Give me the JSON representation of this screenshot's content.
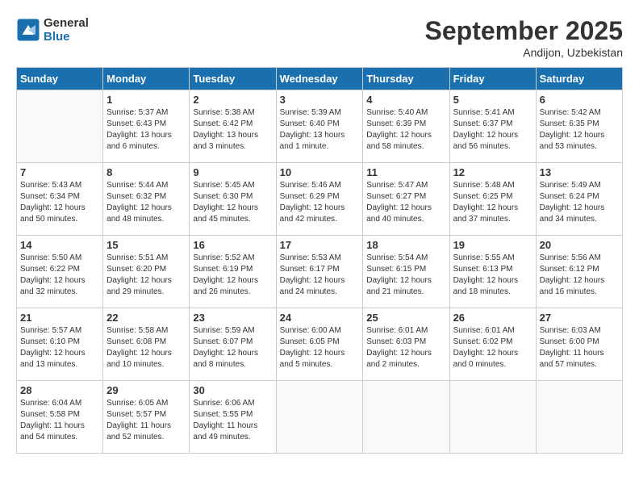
{
  "header": {
    "logo_line1": "General",
    "logo_line2": "Blue",
    "month": "September 2025",
    "location": "Andijon, Uzbekistan"
  },
  "weekdays": [
    "Sunday",
    "Monday",
    "Tuesday",
    "Wednesday",
    "Thursday",
    "Friday",
    "Saturday"
  ],
  "weeks": [
    [
      {
        "day": "",
        "info": ""
      },
      {
        "day": "1",
        "info": "Sunrise: 5:37 AM\nSunset: 6:43 PM\nDaylight: 13 hours\nand 6 minutes."
      },
      {
        "day": "2",
        "info": "Sunrise: 5:38 AM\nSunset: 6:42 PM\nDaylight: 13 hours\nand 3 minutes."
      },
      {
        "day": "3",
        "info": "Sunrise: 5:39 AM\nSunset: 6:40 PM\nDaylight: 13 hours\nand 1 minute."
      },
      {
        "day": "4",
        "info": "Sunrise: 5:40 AM\nSunset: 6:39 PM\nDaylight: 12 hours\nand 58 minutes."
      },
      {
        "day": "5",
        "info": "Sunrise: 5:41 AM\nSunset: 6:37 PM\nDaylight: 12 hours\nand 56 minutes."
      },
      {
        "day": "6",
        "info": "Sunrise: 5:42 AM\nSunset: 6:35 PM\nDaylight: 12 hours\nand 53 minutes."
      }
    ],
    [
      {
        "day": "7",
        "info": "Sunrise: 5:43 AM\nSunset: 6:34 PM\nDaylight: 12 hours\nand 50 minutes."
      },
      {
        "day": "8",
        "info": "Sunrise: 5:44 AM\nSunset: 6:32 PM\nDaylight: 12 hours\nand 48 minutes."
      },
      {
        "day": "9",
        "info": "Sunrise: 5:45 AM\nSunset: 6:30 PM\nDaylight: 12 hours\nand 45 minutes."
      },
      {
        "day": "10",
        "info": "Sunrise: 5:46 AM\nSunset: 6:29 PM\nDaylight: 12 hours\nand 42 minutes."
      },
      {
        "day": "11",
        "info": "Sunrise: 5:47 AM\nSunset: 6:27 PM\nDaylight: 12 hours\nand 40 minutes."
      },
      {
        "day": "12",
        "info": "Sunrise: 5:48 AM\nSunset: 6:25 PM\nDaylight: 12 hours\nand 37 minutes."
      },
      {
        "day": "13",
        "info": "Sunrise: 5:49 AM\nSunset: 6:24 PM\nDaylight: 12 hours\nand 34 minutes."
      }
    ],
    [
      {
        "day": "14",
        "info": "Sunrise: 5:50 AM\nSunset: 6:22 PM\nDaylight: 12 hours\nand 32 minutes."
      },
      {
        "day": "15",
        "info": "Sunrise: 5:51 AM\nSunset: 6:20 PM\nDaylight: 12 hours\nand 29 minutes."
      },
      {
        "day": "16",
        "info": "Sunrise: 5:52 AM\nSunset: 6:19 PM\nDaylight: 12 hours\nand 26 minutes."
      },
      {
        "day": "17",
        "info": "Sunrise: 5:53 AM\nSunset: 6:17 PM\nDaylight: 12 hours\nand 24 minutes."
      },
      {
        "day": "18",
        "info": "Sunrise: 5:54 AM\nSunset: 6:15 PM\nDaylight: 12 hours\nand 21 minutes."
      },
      {
        "day": "19",
        "info": "Sunrise: 5:55 AM\nSunset: 6:13 PM\nDaylight: 12 hours\nand 18 minutes."
      },
      {
        "day": "20",
        "info": "Sunrise: 5:56 AM\nSunset: 6:12 PM\nDaylight: 12 hours\nand 16 minutes."
      }
    ],
    [
      {
        "day": "21",
        "info": "Sunrise: 5:57 AM\nSunset: 6:10 PM\nDaylight: 12 hours\nand 13 minutes."
      },
      {
        "day": "22",
        "info": "Sunrise: 5:58 AM\nSunset: 6:08 PM\nDaylight: 12 hours\nand 10 minutes."
      },
      {
        "day": "23",
        "info": "Sunrise: 5:59 AM\nSunset: 6:07 PM\nDaylight: 12 hours\nand 8 minutes."
      },
      {
        "day": "24",
        "info": "Sunrise: 6:00 AM\nSunset: 6:05 PM\nDaylight: 12 hours\nand 5 minutes."
      },
      {
        "day": "25",
        "info": "Sunrise: 6:01 AM\nSunset: 6:03 PM\nDaylight: 12 hours\nand 2 minutes."
      },
      {
        "day": "26",
        "info": "Sunrise: 6:01 AM\nSunset: 6:02 PM\nDaylight: 12 hours\nand 0 minutes."
      },
      {
        "day": "27",
        "info": "Sunrise: 6:03 AM\nSunset: 6:00 PM\nDaylight: 11 hours\nand 57 minutes."
      }
    ],
    [
      {
        "day": "28",
        "info": "Sunrise: 6:04 AM\nSunset: 5:58 PM\nDaylight: 11 hours\nand 54 minutes."
      },
      {
        "day": "29",
        "info": "Sunrise: 6:05 AM\nSunset: 5:57 PM\nDaylight: 11 hours\nand 52 minutes."
      },
      {
        "day": "30",
        "info": "Sunrise: 6:06 AM\nSunset: 5:55 PM\nDaylight: 11 hours\nand 49 minutes."
      },
      {
        "day": "",
        "info": ""
      },
      {
        "day": "",
        "info": ""
      },
      {
        "day": "",
        "info": ""
      },
      {
        "day": "",
        "info": ""
      }
    ]
  ]
}
